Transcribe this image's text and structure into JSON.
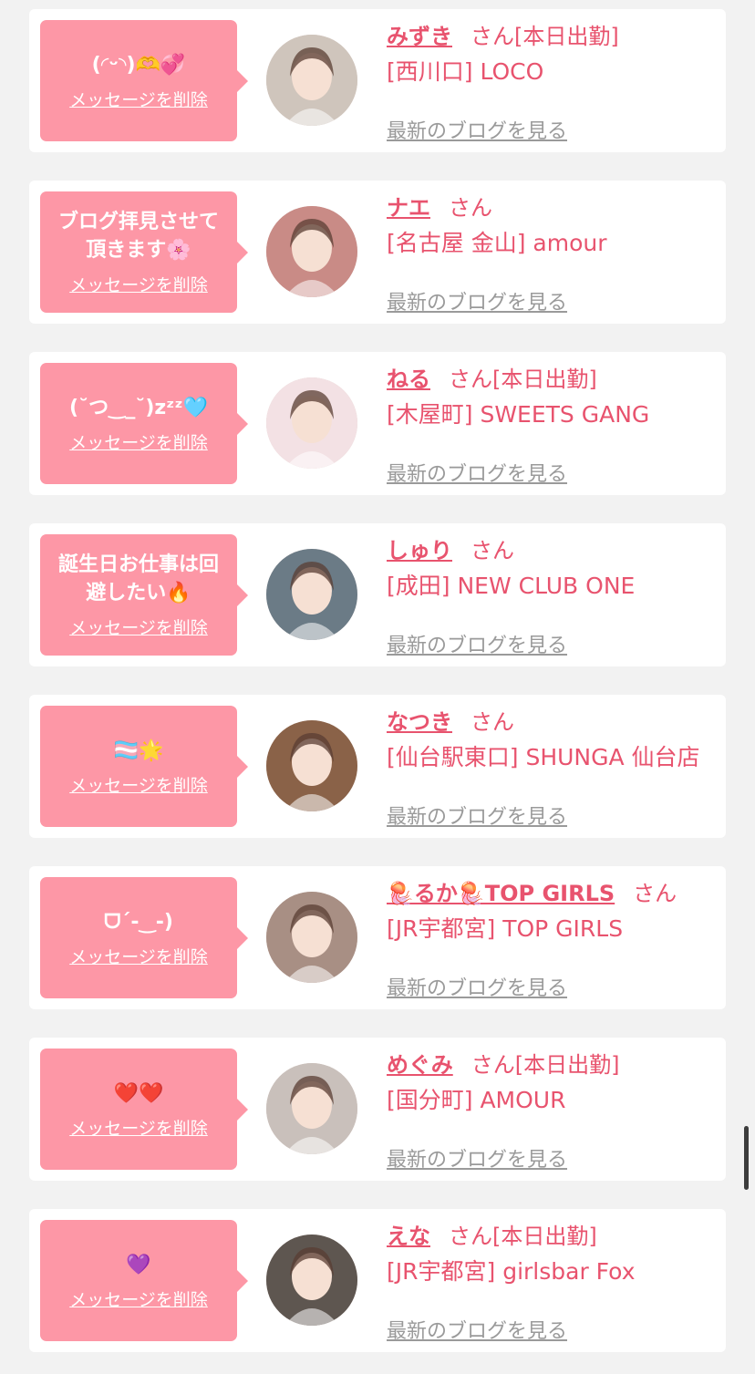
{
  "delete_label": "メッセージを削除",
  "blog_label": "最新のブログを見る",
  "san_label": "さん",
  "messages": [
    {
      "text": "(◜ᵕ◝)🫶💞",
      "name": "みずき",
      "status": "[本日出勤]",
      "shop": "[西川口] LOCO",
      "avatar_color": "#cfc5bc"
    },
    {
      "text": "ブログ拝見させて\n頂きます🌸",
      "name": "ナエ",
      "status": "",
      "shop": "[名古屋 金山] amour",
      "avatar_color": "#c98b86"
    },
    {
      "text": "(˘つ‿_˘)zᶻᶻ🩵",
      "name": "ねる",
      "status": "[本日出勤]",
      "shop": "[木屋町] SWEETS GANG",
      "avatar_color": "#f3e1e4"
    },
    {
      "text": "誕生日お仕事は回\n避したい🔥",
      "name": "しゅり",
      "status": "",
      "shop": "[成田] NEW CLUB ONE",
      "avatar_color": "#6b7b86"
    },
    {
      "text": "🏳️‍⚧️🌟",
      "name": "なつき",
      "status": "",
      "shop": "[仙台駅東口] SHUNGA 仙台店",
      "avatar_color": "#8a6248"
    },
    {
      "text": "ᗜˊ-‿-)",
      "name": "🪼るか🪼TOP GIRLS",
      "status": "",
      "shop": "[JR宇都宮] TOP GIRLS",
      "avatar_color": "#a88f84"
    },
    {
      "text": "❤️❤️",
      "name": "めぐみ",
      "status": "[本日出勤]",
      "shop": "[国分町] AMOUR",
      "avatar_color": "#c9c0bb"
    },
    {
      "text": "💜",
      "name": "えな",
      "status": "[本日出勤]",
      "shop": "[JR宇都宮] girlsbar Fox",
      "avatar_color": "#5e5650"
    }
  ]
}
